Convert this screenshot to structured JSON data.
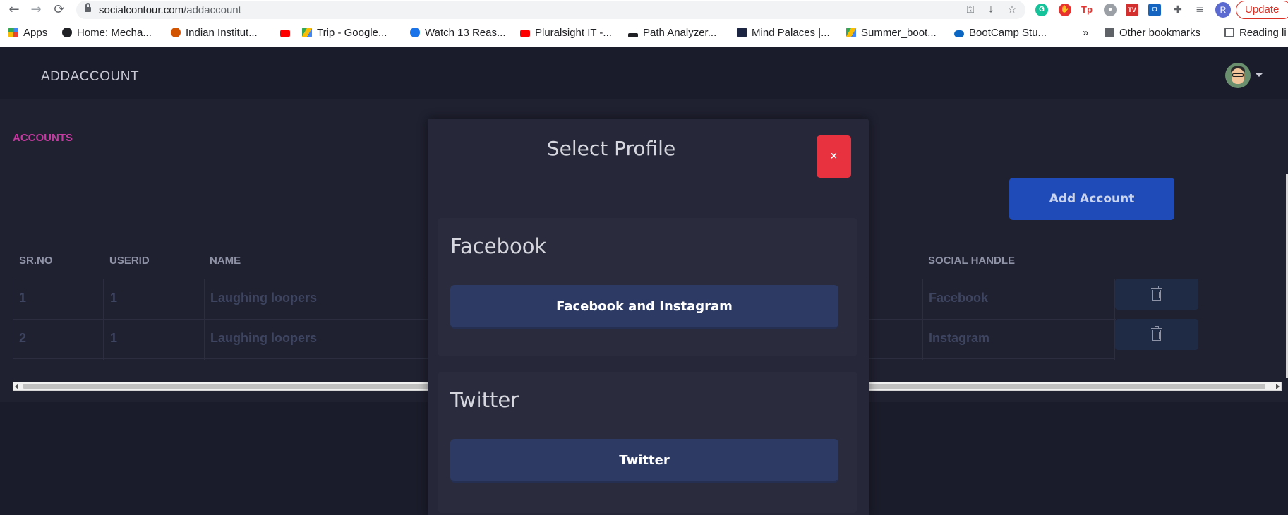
{
  "browser": {
    "url_domain": "socialcontour.com",
    "url_path": "/addaccount",
    "profile_initial": "R",
    "update_label": "Update",
    "bookmarks": [
      {
        "label": "Apps",
        "icon": "apps-grid-icon",
        "color": "#4285f4"
      },
      {
        "label": "Home: Mecha...",
        "icon": "github-icon",
        "color": "#202124"
      },
      {
        "label": "Indian Institut...",
        "icon": "institute-logo-icon",
        "color": "#d35400"
      },
      {
        "label": "",
        "icon": "youtube-icon",
        "color": "#ff0000"
      },
      {
        "label": "Trip - Google...",
        "icon": "google-drive-icon",
        "color": "#34a853"
      },
      {
        "label": "Watch 13 Reas...",
        "icon": "s-logo-icon",
        "color": "#1a73e8"
      },
      {
        "label": "Pluralsight IT -...",
        "icon": "youtube-icon",
        "color": "#ff0000"
      },
      {
        "label": "Path Analyzer...",
        "icon": "path-analyzer-icon",
        "color": "#202124"
      },
      {
        "label": "Mind Palaces |...",
        "icon": "h-logo-icon",
        "color": "#1c2541"
      },
      {
        "label": "Summer_boot...",
        "icon": "google-drive-icon",
        "color": "#fbbc04"
      },
      {
        "label": "BootCamp Stu...",
        "icon": "onedrive-icon",
        "color": "#0a66c2"
      }
    ],
    "overflow": "»",
    "other_bookmarks": "Other bookmarks",
    "reading_list": "Reading li"
  },
  "app": {
    "title": "ADDACCOUNT",
    "section_label": "ACCOUNTS",
    "add_account_label": "Add Account",
    "table": {
      "headers": [
        "SR.NO",
        "USERID",
        "NAME",
        "SOCIAL HANDLE"
      ],
      "rows": [
        {
          "srno": "1",
          "userid": "1",
          "name": "Laughing loopers",
          "handle": "Facebook"
        },
        {
          "srno": "2",
          "userid": "1",
          "name": "Laughing loopers",
          "handle": "Instagram"
        }
      ]
    }
  },
  "modal": {
    "title": "Select Profile",
    "close_label": "×",
    "sections": [
      {
        "title": "Facebook",
        "button": "Facebook and Instagram"
      },
      {
        "title": "Twitter",
        "button": "Twitter"
      }
    ]
  },
  "colors": {
    "accent_pink": "#c53aa0",
    "primary_blue": "#1e4bb8",
    "danger_red": "#e8323f"
  }
}
